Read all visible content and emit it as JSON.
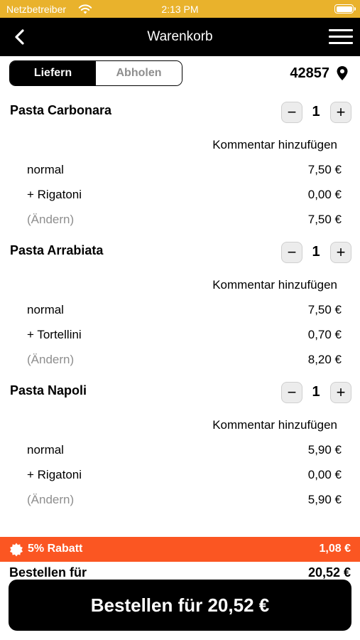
{
  "status_bar": {
    "carrier": "Netzbetreiber",
    "time": "2:13 PM"
  },
  "nav": {
    "title": "Warenkorb"
  },
  "delivery": {
    "options": [
      {
        "label": "Liefern",
        "active": true
      },
      {
        "label": "Abholen",
        "active": false
      }
    ],
    "postal_code": "42857"
  },
  "cart": {
    "comment_label": "Kommentar hinzufügen",
    "stepper": {
      "minus": "−",
      "plus": "+"
    },
    "items": [
      {
        "name": "Pasta Carbonara",
        "quantity": "1",
        "lines": [
          {
            "label": "normal",
            "price": "7,50 €"
          },
          {
            "label": "+ Rigatoni",
            "price": "0,00 €"
          },
          {
            "label": "(Ändern)",
            "price": "7,50 €"
          }
        ]
      },
      {
        "name": "Pasta Arrabiata",
        "quantity": "1",
        "lines": [
          {
            "label": "normal",
            "price": "7,50 €"
          },
          {
            "label": "+ Tortellini",
            "price": "0,70 €"
          },
          {
            "label": "(Ändern)",
            "price": "8,20 €"
          }
        ]
      },
      {
        "name": "Pasta Napoli",
        "quantity": "1",
        "lines": [
          {
            "label": "normal",
            "price": "5,90 €"
          },
          {
            "label": "+ Rigatoni",
            "price": "0,00 €"
          },
          {
            "label": "(Ändern)",
            "price": "5,90 €"
          }
        ]
      }
    ]
  },
  "discount": {
    "label": "5% Rabatt",
    "amount": "1,08 €"
  },
  "summary": {
    "label": "Bestellen für",
    "amount": "20,52 €"
  },
  "order_button": {
    "label": "Bestellen für 20,52 €"
  },
  "colors": {
    "status_bar": "#e9b22c",
    "nav_bar": "#000000",
    "discount": "#fb5622",
    "muted_text": "#8e8e8e"
  },
  "icons": [
    "wifi-icon",
    "battery-icon",
    "back-arrow-icon",
    "hamburger-menu-icon",
    "location-pin-icon",
    "discount-badge-icon"
  ]
}
